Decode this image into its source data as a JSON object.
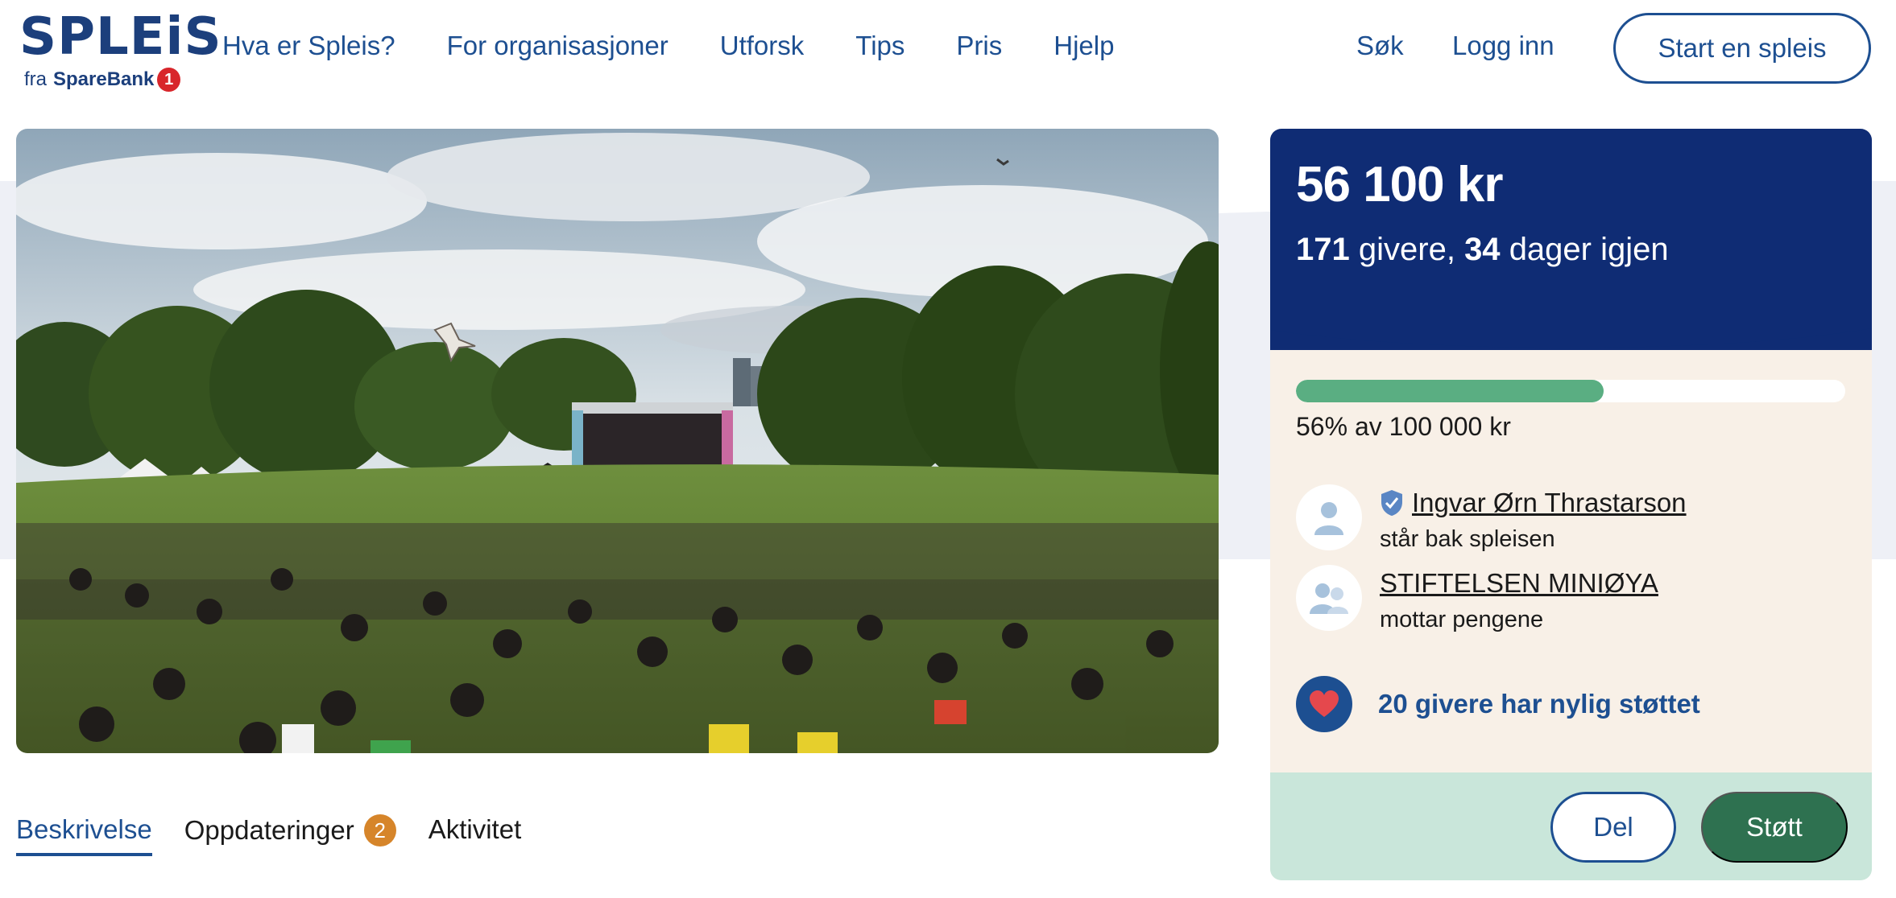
{
  "brand": {
    "logo_text": "SPLEiS",
    "logo_sub_prefix": "fra",
    "logo_sub_bank": "SpareBank",
    "logo_sub_one": "1"
  },
  "nav": {
    "items": [
      {
        "label": "Hva er Spleis?"
      },
      {
        "label": "For organisasjoner"
      },
      {
        "label": "Utforsk"
      },
      {
        "label": "Tips"
      },
      {
        "label": "Pris"
      },
      {
        "label": "Hjelp"
      }
    ],
    "search_label": "Søk",
    "login_label": "Logg inn",
    "start_label": "Start en spleis"
  },
  "campaign": {
    "amount": "56 100 kr",
    "givers_count": "171",
    "givers_text": "givere,",
    "days_count": "34",
    "days_text": "dager igjen",
    "progress_fraction": 0.56,
    "progress_text": "56% av 100 000 kr",
    "owner_name": "Ingvar Ørn Thrastarson",
    "owner_role": "står bak spleisen",
    "recipient_name": "STIFTELSEN MINIØYA",
    "recipient_role": "mottar pengene",
    "recent_supporters": "20 givere har nylig støttet",
    "share_label": "Del",
    "support_label": "Støtt"
  },
  "tabs": [
    {
      "label": "Beskrivelse",
      "active": true
    },
    {
      "label": "Oppdateringer",
      "badge": "2"
    },
    {
      "label": "Aktivitet"
    }
  ],
  "colors": {
    "brand_blue": "#1d4f91",
    "dark_navy": "#0f2c74",
    "progress_green": "#5aae82",
    "support_green": "#2e7150",
    "card_beige": "#f8f0e7",
    "card_bottom_mint": "#c9e6da",
    "badge_orange": "#d6852a",
    "heart_red": "#e5484d"
  },
  "icons": {
    "verified": "shield-check-icon",
    "owner_avatar": "person-icon",
    "recipient_avatar": "group-icon",
    "recent": "heart-icon"
  }
}
